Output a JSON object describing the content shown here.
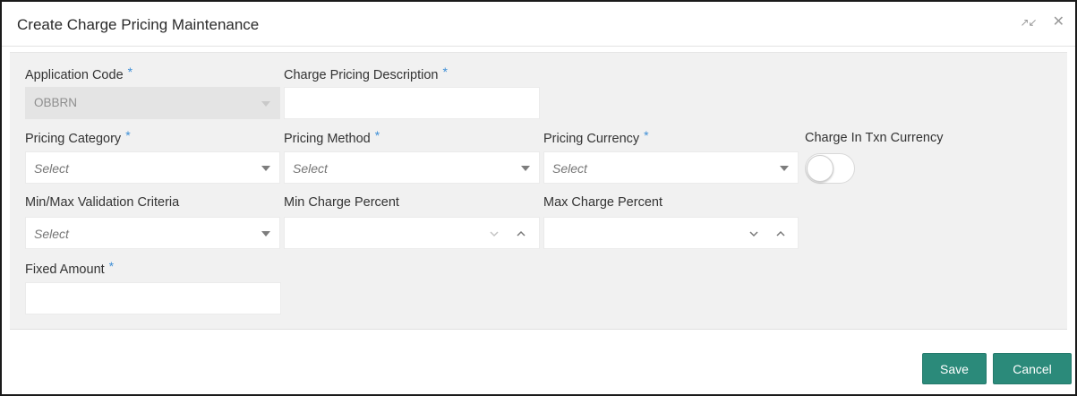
{
  "dialog": {
    "title": "Create Charge Pricing Maintenance",
    "minimize_icon": "minimize-arrows-icon",
    "close_icon": "close-icon"
  },
  "form": {
    "application_code": {
      "label": "Application Code",
      "required": "*",
      "value": "OBBRN"
    },
    "charge_pricing_description": {
      "label": "Charge Pricing Description",
      "required": "*",
      "value": ""
    },
    "pricing_category": {
      "label": "Pricing Category",
      "required": "*",
      "placeholder": "Select"
    },
    "pricing_method": {
      "label": "Pricing Method",
      "required": "*",
      "placeholder": "Select"
    },
    "pricing_currency": {
      "label": "Pricing Currency",
      "required": "*",
      "placeholder": "Select"
    },
    "charge_in_txn_currency": {
      "label": "Charge In Txn Currency",
      "on": false
    },
    "min_max_validation_criteria": {
      "label": "Min/Max Validation Criteria",
      "placeholder": "Select"
    },
    "min_charge_percent": {
      "label": "Min Charge Percent",
      "value": ""
    },
    "max_charge_percent": {
      "label": "Max Charge Percent",
      "value": ""
    },
    "fixed_amount": {
      "label": "Fixed Amount",
      "required": "*",
      "value": ""
    }
  },
  "footer": {
    "save_label": "Save",
    "cancel_label": "Cancel"
  },
  "colors": {
    "required_star": "#3f8fd6",
    "button": "#2b8a7a",
    "panel_bg": "#f1f1f1"
  }
}
